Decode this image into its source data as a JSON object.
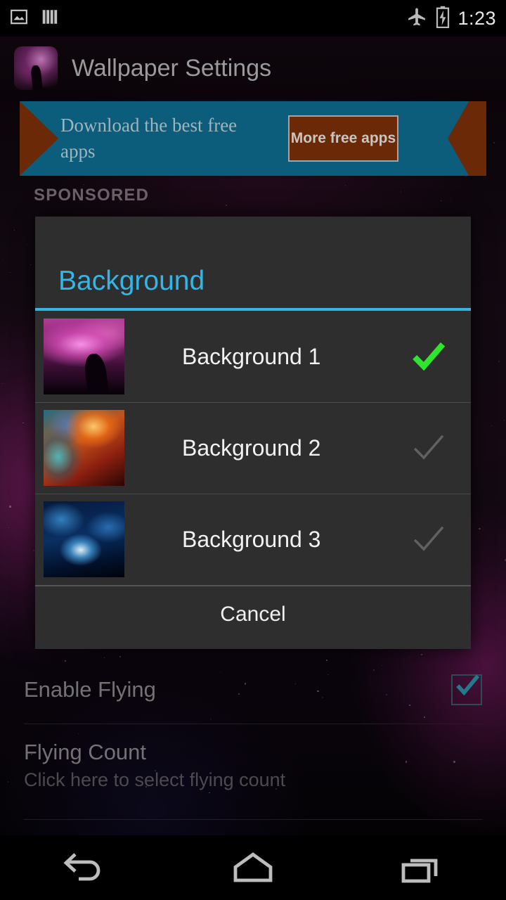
{
  "status_bar": {
    "left_icons": [
      {
        "name": "image-icon",
        "label": "image"
      },
      {
        "name": "sd-storage-bars-icon",
        "label": "storage"
      }
    ],
    "right_icons": [
      {
        "name": "airplane-mode-icon",
        "label": "airplane mode"
      },
      {
        "name": "battery-charging-icon",
        "label": "battery charging"
      }
    ],
    "clock": "1:23"
  },
  "title_bar": {
    "app_title": "Wallpaper Settings",
    "icon_name": "app-icon-nebula"
  },
  "ad": {
    "headline": "Download the best free apps",
    "button_label": "More free apps",
    "sponsored_label": "SPONSORED",
    "banner_color": "#0c5c7b",
    "accent_color": "#6b2908",
    "text_color": "#9fb4bb"
  },
  "dialog": {
    "title": "Background",
    "accent_color": "#33b5e5",
    "background_color": "#2e2e2e",
    "items": [
      {
        "label": "Background 1",
        "selected": true,
        "thumb": "thumb-1",
        "thumb_desc": "pink nebula"
      },
      {
        "label": "Background 2",
        "selected": false,
        "thumb": "thumb-2",
        "thumb_desc": "orange teal nebula"
      },
      {
        "label": "Background 3",
        "selected": false,
        "thumb": "thumb-3",
        "thumb_desc": "blue nebula"
      }
    ],
    "cancel_label": "Cancel",
    "check_selected_color": "#2ee62e",
    "check_unselected_color": "#6a6a6a"
  },
  "preferences": [
    {
      "title": "Enable Flying",
      "summary": "",
      "checked": true,
      "checkbox_color": "#2f93ad"
    },
    {
      "title": "Flying Count",
      "summary": "Click here to select flying count",
      "checked": null
    }
  ],
  "nav_bar": {
    "buttons": [
      {
        "name": "back-button",
        "label": "Back"
      },
      {
        "name": "home-button",
        "label": "Home"
      },
      {
        "name": "recents-button",
        "label": "Recents"
      }
    ]
  }
}
